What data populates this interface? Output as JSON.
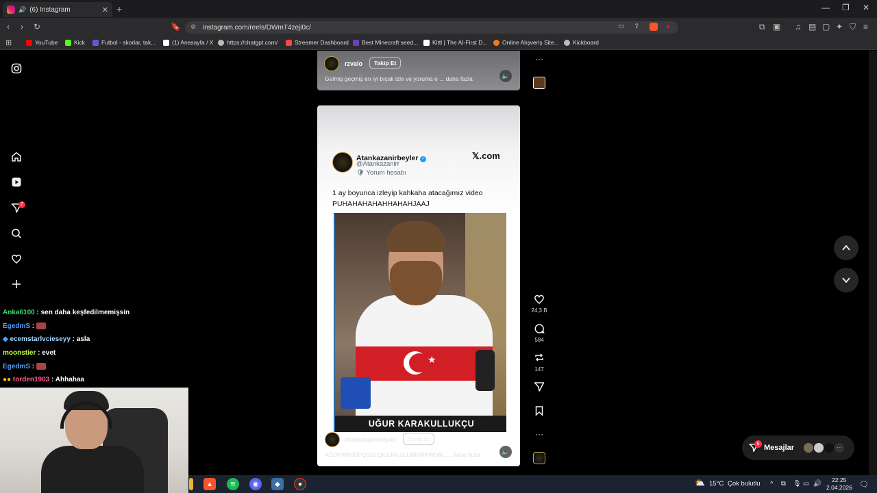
{
  "browser": {
    "tab_title": "(6) Instagram",
    "url": "instagram.com/reels/DWmT4zeji0c/",
    "new_tab": "+",
    "bookmarks": [
      {
        "label": "YouTube",
        "color": "#ff0000"
      },
      {
        "label": "Kick",
        "color": "#53fc18"
      },
      {
        "label": "Futbol - skorlar, tak...",
        "color": "#5b5bd6"
      },
      {
        "label": "(1) Anasayfa / X",
        "color": "#ffffff"
      },
      {
        "label": "https://chatgpt.com/",
        "color": "#bbbbbb"
      },
      {
        "label": "Streamer Dashboard",
        "color": "#ff4444"
      },
      {
        "label": "Best Minecraft seed...",
        "color": "#6a3fc9"
      },
      {
        "label": "Kittl | The AI-First D...",
        "color": "#ffffff"
      },
      {
        "label": "Online Alışveriş Site...",
        "color": "#f27a1a"
      },
      {
        "label": "Kickboard",
        "color": "#bbbbbb"
      }
    ]
  },
  "sidebar": {
    "notification_badge": "7"
  },
  "chat": [
    {
      "user": "Anka6100",
      "sep": " : ",
      "text": "sen daha keşfedilmemişsin"
    },
    {
      "user": "EgedmS",
      "sep": " : ",
      "text": ""
    },
    {
      "user": "ecemstarlvcieseyy",
      "sep": " : ",
      "text": "asla"
    },
    {
      "user": "moonstier",
      "sep": " : ",
      "text": "evet"
    },
    {
      "user": "EgedmS",
      "sep": " : ",
      "text": ""
    },
    {
      "user": "torden1903",
      "sep": " : ",
      "text": "Ahhahaa"
    }
  ],
  "prev_reel": {
    "username": "rzvalo",
    "follow": "Takip Et",
    "caption": "Gelmiş geçmiş en iyi bıçak izle ve yoruma e ... daha fazla"
  },
  "reel": {
    "tweet": {
      "name": "Atankazanirbeyler",
      "handle": "@Atankazanirr",
      "sub": "🛡 Yorum hesabı",
      "brand": "𝕏.com",
      "text_line1": "1 ay boyunca izleyip kahkaha atacağımız video",
      "text_line2": "PUHAHAHAHAHHAHAHJAAJ"
    },
    "video_caption": "UĞUR KARAKULLUKÇU",
    "username": "atankazanirbeyler",
    "follow": "Takip Et",
    "caption": "AĞDKWNJSPQŞSLQKSJALSLLWKWKWLWL ... daha fazla",
    "likes": "24,3 B",
    "comments": "584",
    "reposts": "147"
  },
  "messages": {
    "label": "Mesajlar",
    "badge": "6"
  },
  "taskbar": {
    "temperature": "15°C",
    "weather": "Çok bulutlu",
    "time": "22:25",
    "date": "2.04.2026"
  }
}
